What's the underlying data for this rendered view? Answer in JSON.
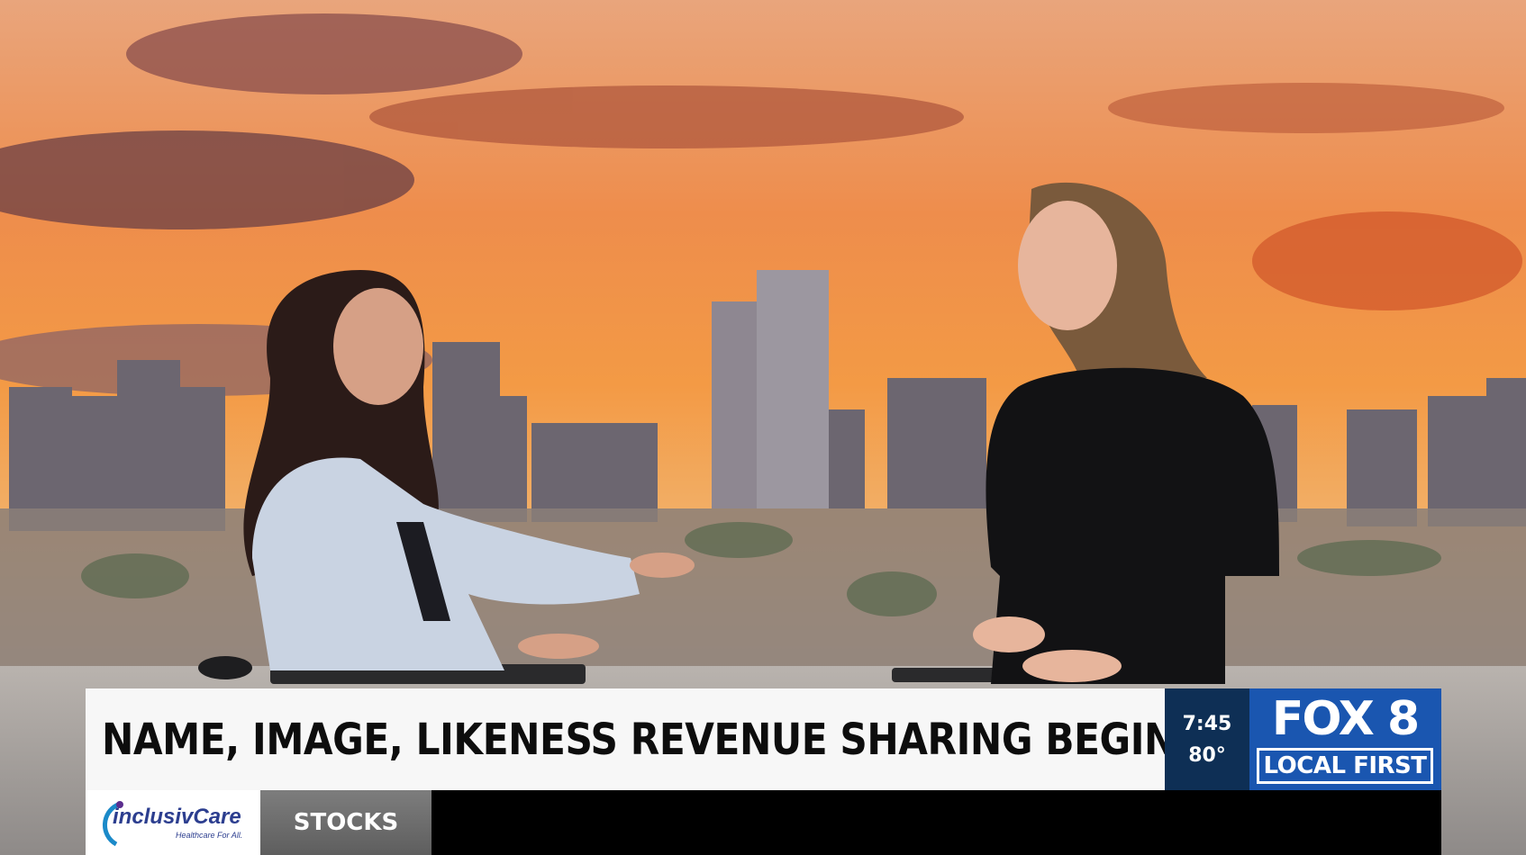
{
  "headline": "NAME, IMAGE, LIKENESS REVENUE SHARING BEGINS",
  "clock": {
    "time": "7:45",
    "temperature": "80°"
  },
  "station": {
    "logo_main": "FOX 8",
    "logo_tagline": "LOCAL FIRST"
  },
  "ticker": {
    "sponsor_name": "inclusivCare",
    "sponsor_tagline": "Healthcare For All.",
    "section_label": "STOCKS"
  },
  "colors": {
    "sky": "#f08a3c",
    "headline_bar": "#f7f7f7",
    "clock_bg": "#0e2f55",
    "logo_bg": "#1a56b0",
    "logo_accent": "#c41a1a"
  }
}
